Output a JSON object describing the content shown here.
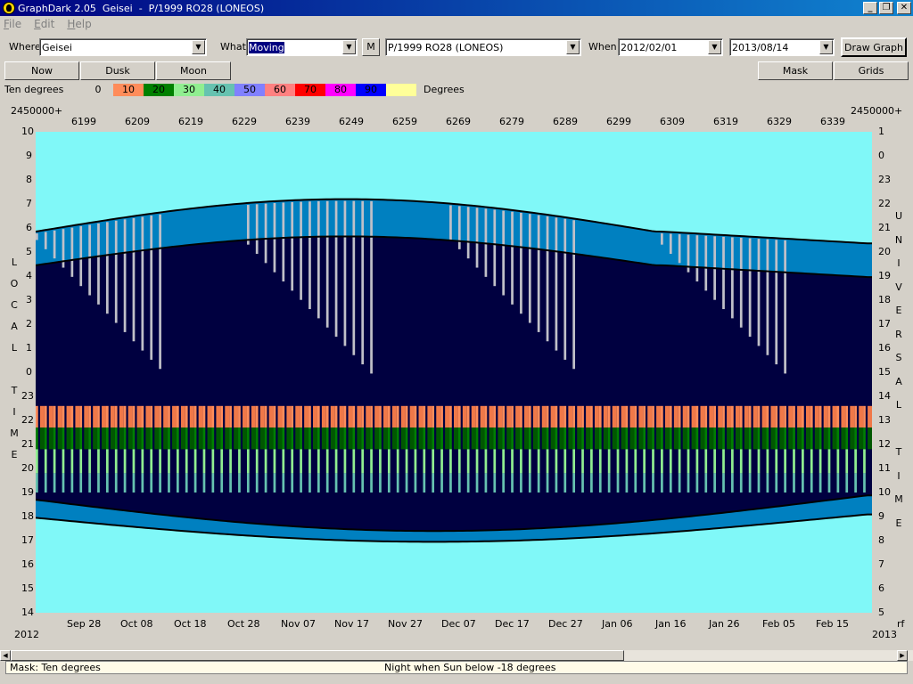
{
  "window": {
    "title": "GraphDark 2.05  Geisei  -  P/1999 RO28 (LONEOS)",
    "buttons": [
      "_",
      "❐",
      "✕"
    ]
  },
  "menu": [
    {
      "label": "File",
      "key": "F"
    },
    {
      "label": "Edit",
      "key": "E"
    },
    {
      "label": "Help",
      "key": "H"
    }
  ],
  "toolbar": {
    "where_label": "Where",
    "where_value": "Geisei",
    "what_label": "What",
    "what_value": "Moving",
    "m_button": "M",
    "object_value": "P/1999 RO28 (LONEOS)",
    "when_label": "When",
    "date_start": "2012/02/01",
    "date_end": "2013/08/14",
    "draw_button": "Draw Graph"
  },
  "buttons": {
    "now": "Now",
    "dusk": "Dusk",
    "moon": "Moon",
    "mask": "Mask",
    "grids": "Grids"
  },
  "legend": {
    "label": "Ten degrees",
    "unit": "Degrees",
    "entries": [
      {
        "value": "0",
        "color": "#f5f5f5"
      },
      {
        "value": "10",
        "color": "#ff8c5a"
      },
      {
        "value": "20",
        "color": "#008000"
      },
      {
        "value": "30",
        "color": "#90ee90"
      },
      {
        "value": "40",
        "color": "#66c2b0"
      },
      {
        "value": "50",
        "color": "#8080ff"
      },
      {
        "value": "60",
        "color": "#ff8080"
      },
      {
        "value": "70",
        "color": "#ff0000"
      },
      {
        "value": "80",
        "color": "#ff00ff"
      },
      {
        "value": "90",
        "color": "#0000ff"
      },
      {
        "value": "",
        "color": "#ffff99"
      }
    ]
  },
  "plot": {
    "jd_prefix": "2450000+",
    "jd_ticks": [
      "6199",
      "6209",
      "6219",
      "6229",
      "6239",
      "6249",
      "6259",
      "6269",
      "6279",
      "6289",
      "6299",
      "6309",
      "6319",
      "6329",
      "6339"
    ],
    "date_ticks": [
      "Sep 28",
      "Oct 08",
      "Oct 18",
      "Oct 28",
      "Nov 07",
      "Nov 17",
      "Nov 27",
      "Dec 07",
      "Dec 17",
      "Dec 27",
      "Jan 06",
      "Jan 16",
      "Jan 26",
      "Feb 05",
      "Feb 15"
    ],
    "year_start": "2012",
    "year_end": "2013",
    "corner_label": "rf",
    "local_hours": [
      "10",
      "9",
      "8",
      "7",
      "6",
      "5",
      "4",
      "3",
      "2",
      "1",
      "0",
      "23",
      "22",
      "21",
      "20",
      "19",
      "18",
      "17",
      "16",
      "15",
      "14"
    ],
    "ut_hours": [
      "1",
      "0",
      "23",
      "22",
      "21",
      "20",
      "19",
      "18",
      "17",
      "16",
      "15",
      "14",
      "13",
      "12",
      "11",
      "10",
      "9",
      "8",
      "7",
      "6",
      "5"
    ],
    "local_time_letters": [
      "L",
      "O",
      "C",
      "A",
      "L",
      "",
      "T",
      "I",
      "M",
      "E"
    ],
    "universal_time_letters": [
      "U",
      "N",
      "I",
      "V",
      "E",
      "R",
      "S",
      "A",
      "L",
      "",
      "T",
      "I",
      "M",
      "E"
    ],
    "colors": {
      "sky_day": "#80f8f8",
      "twilight": "#0080c0",
      "night": "#000040",
      "object": "#c0c0c8"
    }
  },
  "status": {
    "mask": "Mask:  Ten degrees",
    "night": "Night when Sun below -18 degrees"
  }
}
